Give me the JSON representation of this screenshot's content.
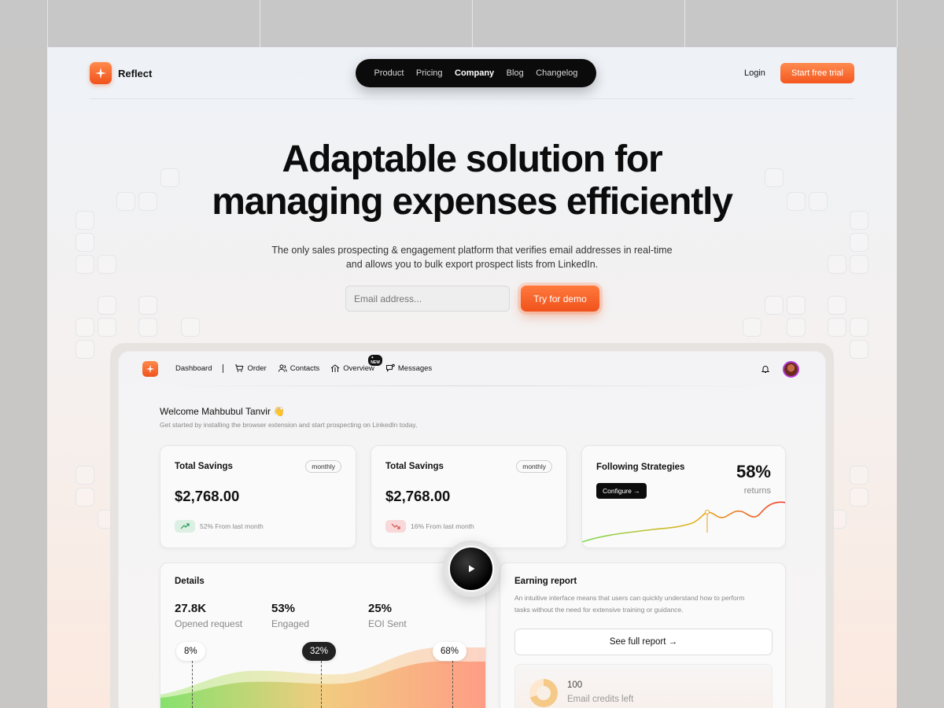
{
  "site": {
    "brand": "Reflect",
    "nav": [
      "Product",
      "Pricing",
      "Company",
      "Blog",
      "Changelog"
    ],
    "active_nav": "Company",
    "login": "Login",
    "cta": "Start free trial"
  },
  "hero": {
    "title_line1": "Adaptable solution for",
    "title_line2": "managing expenses efficiently",
    "subtitle": "The only sales prospecting & engagement platform that verifies email addresses in real-time and allows you to bulk export prospect lists from LinkedIn.",
    "email_placeholder": "Email address...",
    "demo_button": "Try for demo"
  },
  "dashboard": {
    "nav": {
      "dashboard": "Dashboard",
      "order": "Order",
      "contacts": "Contacts",
      "overview": "Overview",
      "overview_badge": "✦ NEW",
      "messages": "Messages"
    },
    "welcome_title": "Welcome Mahbubul Tanvir 👋",
    "welcome_sub": "Get started by installing the browser extension and start prospecting on LinkedIn today,",
    "cards": [
      {
        "title": "Total Savings",
        "chip": "monthly",
        "amount": "$2,768.00",
        "trend": "52% From last month",
        "direction": "up"
      },
      {
        "title": "Total Savings",
        "chip": "monthly",
        "amount": "$2,768.00",
        "trend": "16% From last month",
        "direction": "down"
      }
    ],
    "strategies": {
      "title": "Following Strategies",
      "button": "Configure →",
      "percent": "58%",
      "label": "returns"
    },
    "details": {
      "title": "Details",
      "stats": [
        {
          "value": "27.8K",
          "label": "Opened request"
        },
        {
          "value": "53%",
          "label": "Engaged"
        },
        {
          "value": "25%",
          "label": "EOI Sent"
        }
      ],
      "bubbles": [
        "8%",
        "32%",
        "68%"
      ]
    },
    "earning": {
      "title": "Earning report",
      "description": "An intuitive interface means that users can quickly understand how to perform tasks without the need for extensive training or guidance.",
      "button": "See full report →",
      "credits_value": "100",
      "credits_label": "Email credits left"
    }
  },
  "colors": {
    "accent": "#f4571f",
    "dark": "#0b0b0b",
    "up": "#2e9a5a",
    "down": "#d9534f"
  },
  "icons": [
    "sparkle-logo-icon",
    "cart-icon",
    "contacts-icon",
    "overview-icon",
    "messages-icon",
    "bell-icon",
    "trend-up-icon",
    "trend-down-icon",
    "play-icon",
    "arrow-right-icon"
  ]
}
